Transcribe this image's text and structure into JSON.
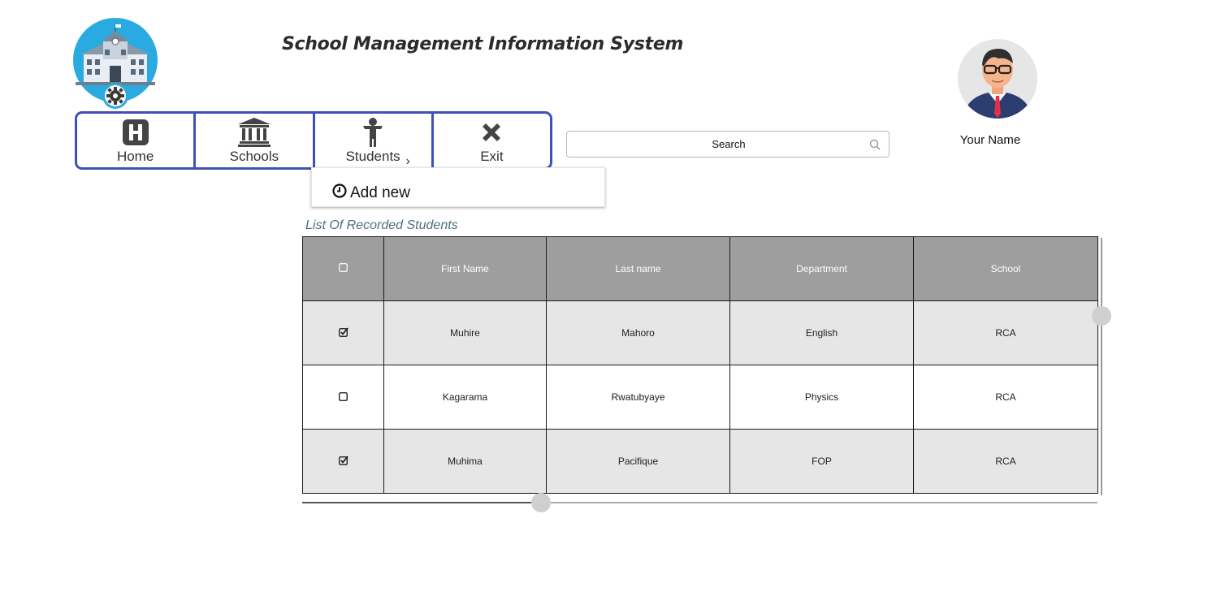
{
  "header": {
    "title": "School Management Information System"
  },
  "nav": {
    "items": [
      {
        "label": "Home",
        "icon": "hospital-h-icon"
      },
      {
        "label": "Schools",
        "icon": "institution-icon"
      },
      {
        "label": "Students",
        "icon": "child-icon"
      },
      {
        "label": "Exit",
        "icon": "close-x-icon"
      }
    ],
    "dropdown": {
      "items": [
        {
          "label": "Add new",
          "icon": "clock-icon"
        }
      ]
    },
    "colors": {
      "border": "#3f51b5"
    }
  },
  "search": {
    "placeholder": "Search"
  },
  "user": {
    "name": "Your Name"
  },
  "list": {
    "caption": "List Of Recorded Students",
    "columns": [
      "",
      "First Name",
      "Last name",
      "Department",
      "School"
    ],
    "rows": [
      {
        "checked": true,
        "first_name": "Muhire",
        "last_name": "Mahoro",
        "department": "English",
        "school": "RCA"
      },
      {
        "checked": false,
        "first_name": "Kagarama",
        "last_name": "Rwatubyaye",
        "department": "Physics",
        "school": "RCA"
      },
      {
        "checked": true,
        "first_name": "Muhima",
        "last_name": "Pacifique",
        "department": "FOP",
        "school": "RCA"
      }
    ]
  }
}
